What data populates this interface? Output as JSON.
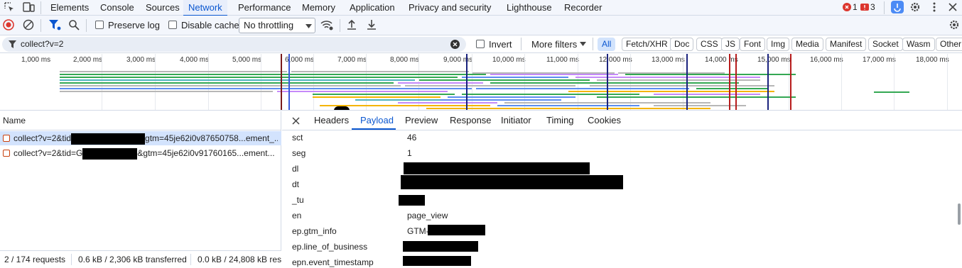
{
  "main_tabs": [
    {
      "label": "Elements"
    },
    {
      "label": "Console"
    },
    {
      "label": "Sources"
    },
    {
      "label": "Network",
      "active": true
    },
    {
      "label": "Performance"
    },
    {
      "label": "Memory"
    },
    {
      "label": "Application"
    },
    {
      "label": "Privacy and security"
    },
    {
      "label": "Lighthouse"
    },
    {
      "label": "Recorder"
    }
  ],
  "indicators": {
    "errors": "1",
    "issues": "3"
  },
  "toolbar": {
    "preserve_log": "Preserve log",
    "disable_cache": "Disable cache",
    "throttling": "No throttling"
  },
  "filter": {
    "value": "collect?v=2",
    "invert": "Invert",
    "more_filters": "More filters",
    "types": [
      "All",
      "Fetch/XHR",
      "Doc",
      "CSS",
      "JS",
      "Font",
      "Img",
      "Media",
      "Manifest",
      "Socket",
      "Wasm",
      "Other"
    ],
    "active_type": "All"
  },
  "timeline": {
    "ticks": [
      "1,000 ms",
      "2,000 ms",
      "3,000 ms",
      "4,000 ms",
      "5,000 ms",
      "6,000 ms",
      "7,000 ms",
      "8,000 ms",
      "9,000 ms",
      "10,000 ms",
      "11,000 ms",
      "12,000 ms",
      "13,000 ms",
      "14,000 ms",
      "15,000 ms",
      "16,000 ms",
      "17,000 ms",
      "18,000 ms"
    ]
  },
  "request_list": {
    "header": "Name",
    "rows": [
      {
        "prefix": "collect?v=2&tid",
        "suffix": "gtm=45je62i0v87650758...ement_...",
        "selected": true
      },
      {
        "prefix": "collect?v=2&tid=G",
        "suffix": "&gtm=45je62i0v91760165...ement...",
        "selected": false
      }
    ]
  },
  "status": {
    "requests": "2 / 174 requests",
    "transferred": "0.6 kB / 2,306 kB transferred",
    "resources": "0.0 kB / 24,808 kB resources"
  },
  "detail_tabs": [
    {
      "label": "Headers"
    },
    {
      "label": "Payload",
      "active": true
    },
    {
      "label": "Preview"
    },
    {
      "label": "Response"
    },
    {
      "label": "Initiator"
    },
    {
      "label": "Timing"
    },
    {
      "label": "Cookies"
    }
  ],
  "payload": [
    {
      "key": "sct",
      "value": "46"
    },
    {
      "key": "seg",
      "value": "1"
    },
    {
      "key": "dl",
      "value": ""
    },
    {
      "key": "dt",
      "value": ""
    },
    {
      "key": "_tu",
      "value": ""
    },
    {
      "key": "en",
      "value": "page_view"
    },
    {
      "key": "ep.gtm_info",
      "value": "GTM-"
    },
    {
      "key": "ep.line_of_business",
      "value": ""
    },
    {
      "key": "epn.event_timestamp",
      "value": ""
    }
  ],
  "colors": {
    "accent": "#0b57d0",
    "error_red": "#dc362e",
    "record_red": "#dc362e",
    "bar_gray": "#b7b7b7",
    "bar_green": "#34a853",
    "bar_blue": "#5b8def",
    "bar_purple": "#c58af9",
    "bar_yellow": "#f4b400",
    "bar_teal": "#4fb3bf"
  },
  "icons": [
    "inspect-icon",
    "device-icon",
    "error-icon",
    "issue-icon",
    "settings-icon",
    "more-icon",
    "close-icon",
    "record-icon",
    "clear-icon",
    "filter-icon",
    "search-icon",
    "network-conditions-icon",
    "import-icon",
    "export-icon",
    "clear-filter-icon",
    "dropdown-icon",
    "close-panel-icon",
    "profile-icon"
  ]
}
